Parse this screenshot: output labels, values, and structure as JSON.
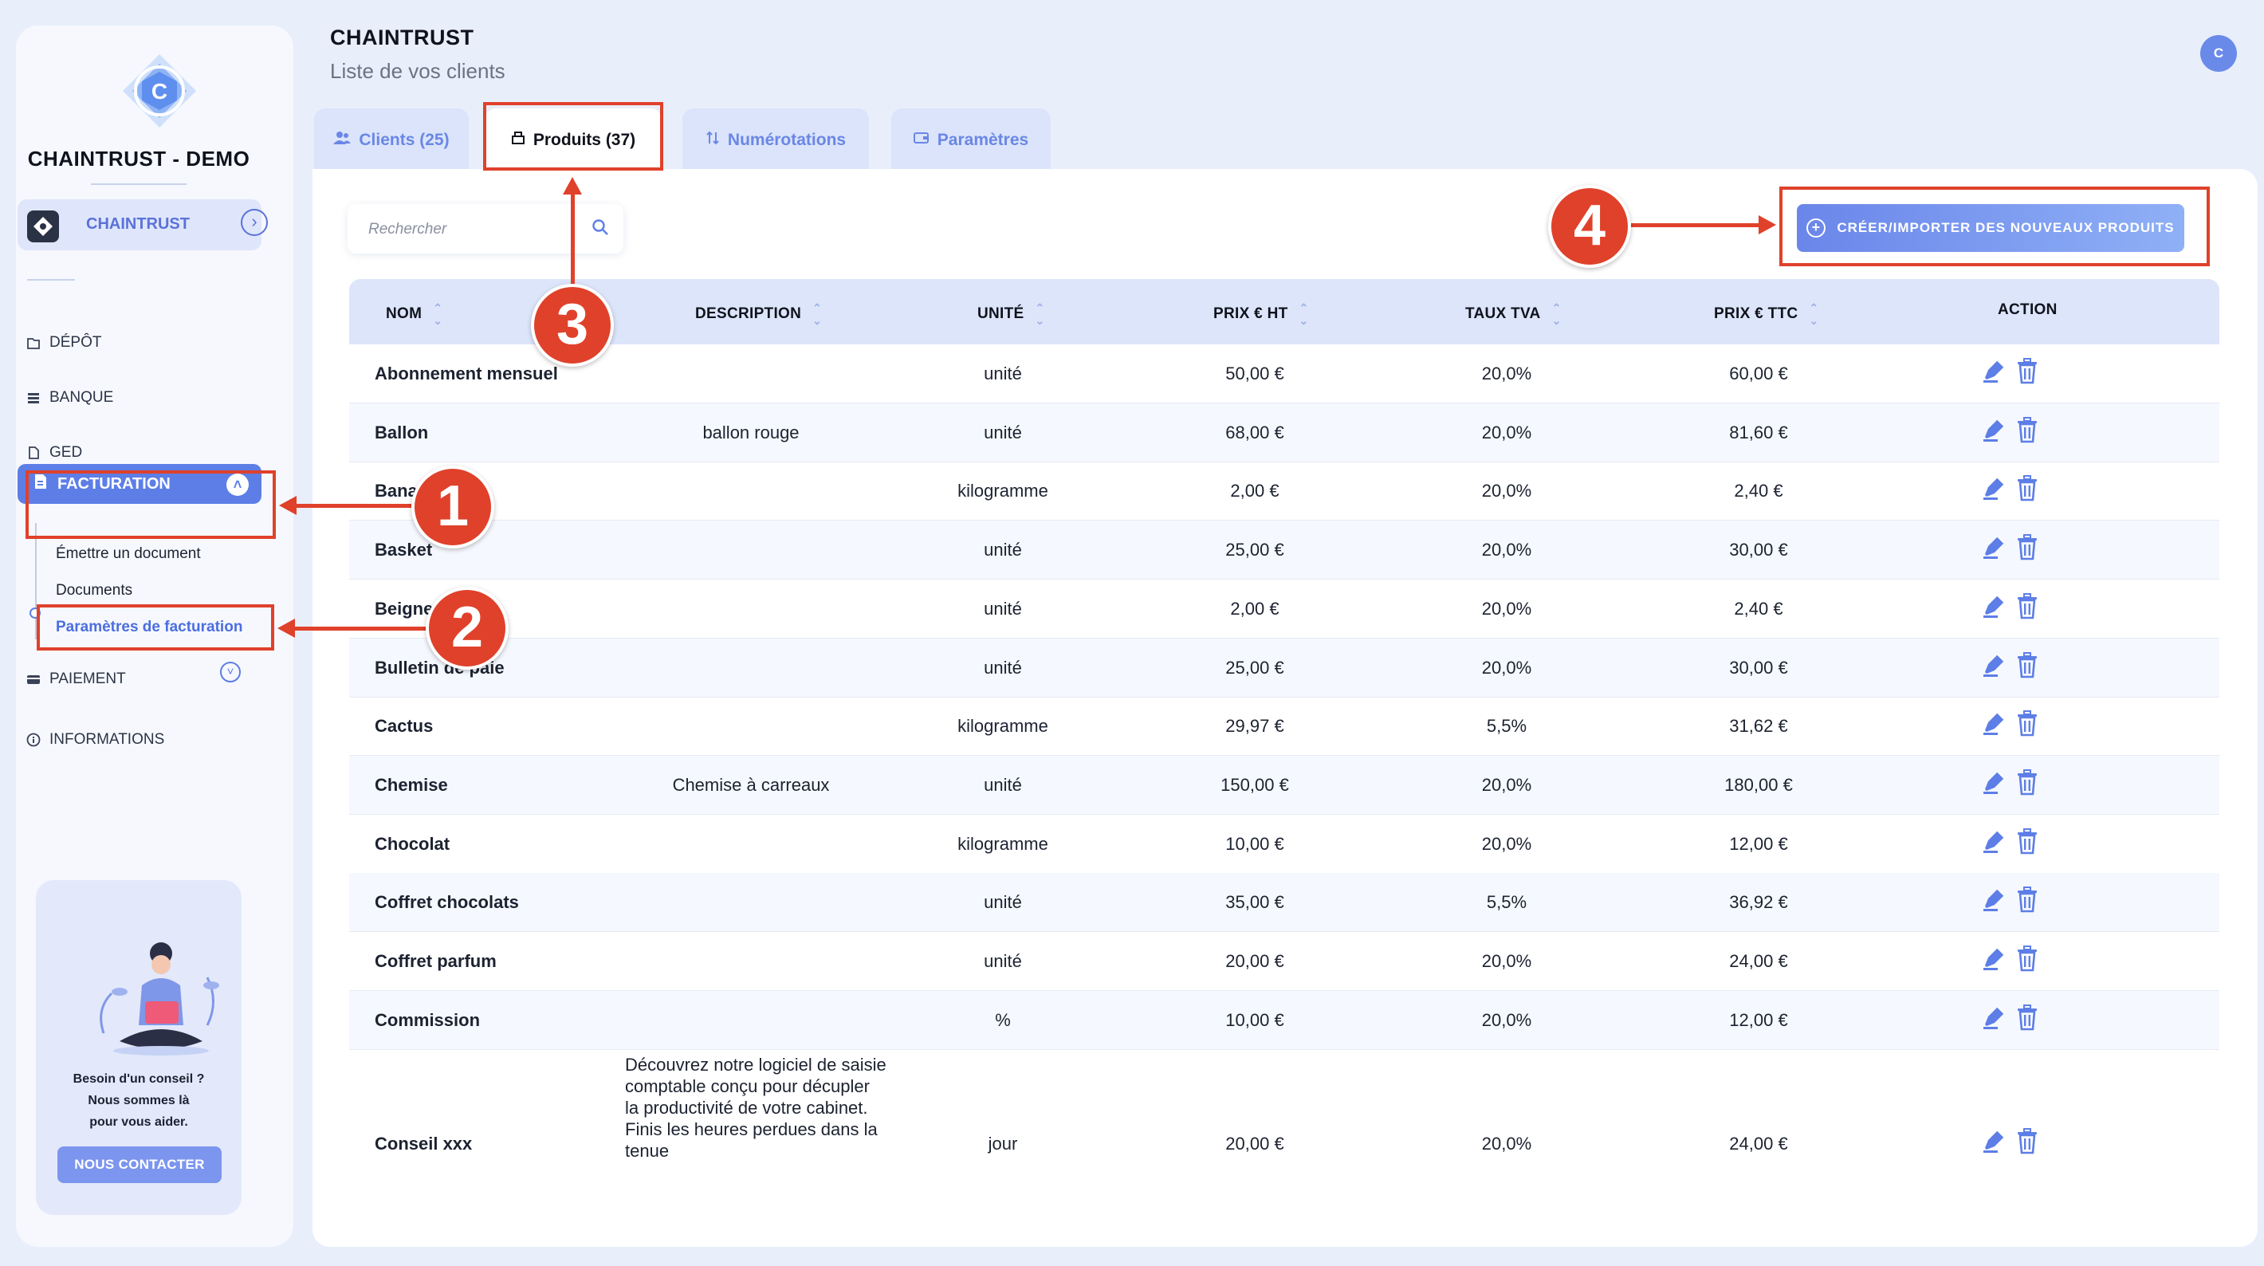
{
  "app": {
    "title": "CHAINTRUST",
    "subtitle": "Liste de vos clients",
    "avatar_initial": "C"
  },
  "sidebar": {
    "brand": "CHAINTRUST - DEMO",
    "current_account": "CHAINTRUST",
    "items": [
      {
        "label": "DÉPÔT",
        "icon": "upload-icon"
      },
      {
        "label": "BANQUE",
        "icon": "bank-icon"
      },
      {
        "label": "GED",
        "icon": "document-icon"
      },
      {
        "label": "FACTURATION",
        "icon": "invoice-icon",
        "active": true
      },
      {
        "label": "PAIEMENT",
        "icon": "card-icon"
      },
      {
        "label": "INFORMATIONS",
        "icon": "info-icon"
      }
    ],
    "facturation_sub": [
      "Émettre un document",
      "Documents",
      "Paramètres de facturation"
    ],
    "help": {
      "line1": "Besoin d'un conseil ?",
      "line2": "Nous sommes là",
      "line3": "pour vous aider.",
      "button": "NOUS CONTACTER"
    }
  },
  "tabs": [
    {
      "label": "Clients (25)",
      "icon": "users-icon"
    },
    {
      "label": "Produits (37)",
      "icon": "box-icon",
      "active": true
    },
    {
      "label": "Numérotations",
      "icon": "sort-icon"
    },
    {
      "label": "Paramètres",
      "icon": "wallet-icon"
    }
  ],
  "search": {
    "placeholder": "Rechercher",
    "value": ""
  },
  "create_button": "CRÉER/IMPORTER DES NOUVEAUX PRODUITS",
  "table": {
    "headers": [
      "NOM",
      "DESCRIPTION",
      "UNITÉ",
      "PRIX € HT",
      "TAUX TVA",
      "PRIX € TTC",
      "ACTION"
    ],
    "rows": [
      {
        "nom": "Abonnement mensuel",
        "description": "",
        "unite": "unité",
        "ht": "50,00 €",
        "tva": "20,0%",
        "ttc": "60,00 €"
      },
      {
        "nom": "Ballon",
        "description": "ballon rouge",
        "unite": "unité",
        "ht": "68,00 €",
        "tva": "20,0%",
        "ttc": "81,60 €"
      },
      {
        "nom": "Bana",
        "description": "",
        "unite": "kilogramme",
        "ht": "2,00 €",
        "tva": "20,0%",
        "ttc": "2,40 €"
      },
      {
        "nom": "Basket",
        "description": "",
        "unite": "unité",
        "ht": "25,00 €",
        "tva": "20,0%",
        "ttc": "30,00 €"
      },
      {
        "nom": "Beignet",
        "description": "",
        "unite": "unité",
        "ht": "2,00 €",
        "tva": "20,0%",
        "ttc": "2,40 €"
      },
      {
        "nom": "Bulletin de paie",
        "description": "",
        "unite": "unité",
        "ht": "25,00 €",
        "tva": "20,0%",
        "ttc": "30,00 €"
      },
      {
        "nom": "Cactus",
        "description": "",
        "unite": "kilogramme",
        "ht": "29,97 €",
        "tva": "5,5%",
        "ttc": "31,62 €"
      },
      {
        "nom": "Chemise",
        "description": "Chemise à carreaux",
        "unite": "unité",
        "ht": "150,00 €",
        "tva": "20,0%",
        "ttc": "180,00 €"
      },
      {
        "nom": "Chocolat",
        "description": "",
        "unite": "kilogramme",
        "ht": "10,00 €",
        "tva": "20,0%",
        "ttc": "12,00 €"
      },
      {
        "nom": "Coffret chocolats",
        "description": "",
        "unite": "unité",
        "ht": "35,00 €",
        "tva": "5,5%",
        "ttc": "36,92 €"
      },
      {
        "nom": "Coffret parfum",
        "description": "",
        "unite": "unité",
        "ht": "20,00 €",
        "tva": "20,0%",
        "ttc": "24,00 €"
      },
      {
        "nom": "Commission",
        "description": "",
        "unite": "%",
        "ht": "10,00 €",
        "tva": "20,0%",
        "ttc": "12,00 €"
      },
      {
        "nom": "Conseil xxx",
        "description": "Découvrez notre logiciel de saisie comptable conçu pour décupler la productivité de votre cabinet. Finis les heures perdues dans la tenue",
        "unite": "jour",
        "ht": "20,00 €",
        "tva": "20,0%",
        "ttc": "24,00 €"
      }
    ]
  },
  "annotations": [
    "1",
    "2",
    "3",
    "4"
  ],
  "colors": {
    "accent": "#5d7ee6",
    "annotation": "#e0412b",
    "background": "#e9eefb"
  }
}
